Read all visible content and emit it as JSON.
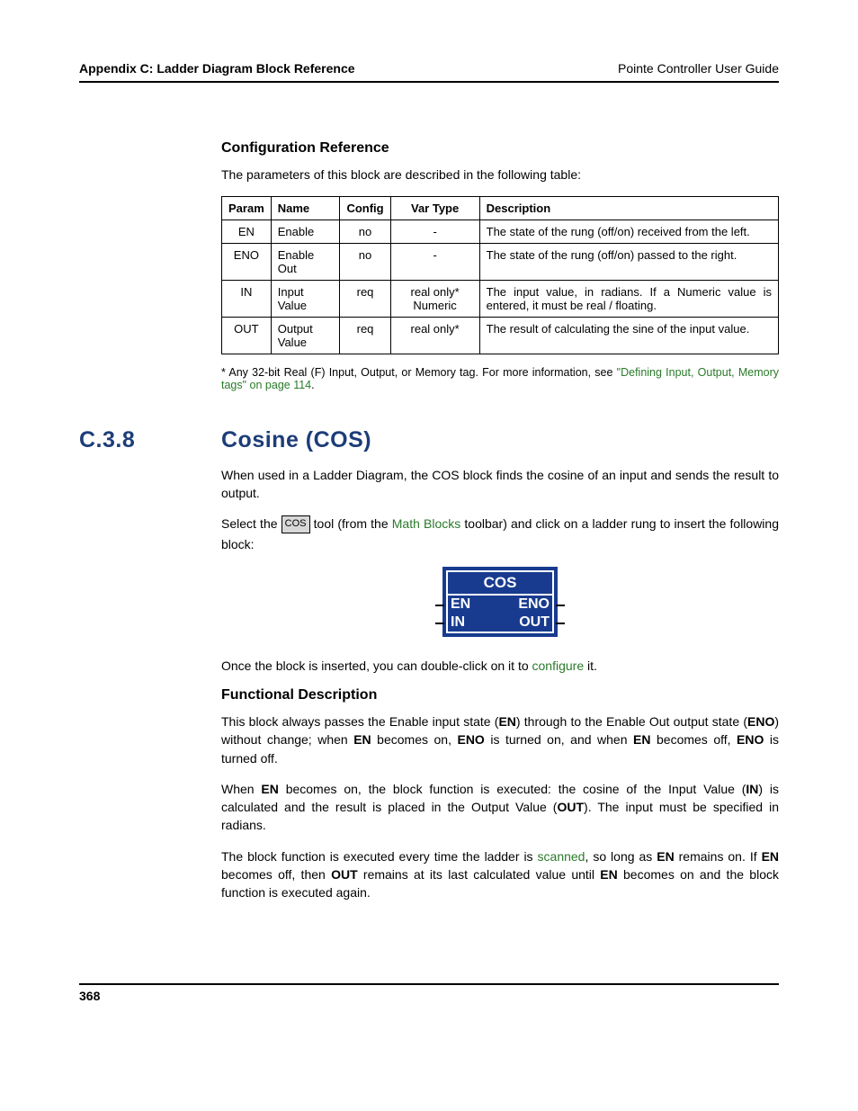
{
  "header": {
    "left": "Appendix C: Ladder Diagram Block Reference",
    "right": "Pointe Controller User Guide"
  },
  "config_ref": {
    "heading": "Configuration Reference",
    "intro": "The parameters of this block are described in the following table:",
    "th": {
      "param": "Param",
      "name": "Name",
      "config": "Config",
      "vartype": "Var Type",
      "desc": "Description"
    },
    "rows": [
      {
        "param": "EN",
        "name": "Enable",
        "config": "no",
        "vartype": "-",
        "desc": "The state of the rung (off/on) received from the left."
      },
      {
        "param": "ENO",
        "name": "Enable Out",
        "config": "no",
        "vartype": "-",
        "desc": "The state of the rung (off/on) passed to the right."
      },
      {
        "param": "IN",
        "name": "Input Value",
        "config": "req",
        "vartype": "real only* Numeric",
        "desc": "The input value, in radians. If a Numeric value is entered, it must be real / floating."
      },
      {
        "param": "OUT",
        "name": "Output Value",
        "config": "req",
        "vartype": "real only*",
        "desc": "The result of calculating the sine of the input value."
      }
    ],
    "footnote": {
      "prefix": "* Any 32-bit Real (F) Input, Output, or Memory tag. For more information, see ",
      "link": "\"Defining Input, Output, Memory tags\" on page 114",
      "suffix": "."
    }
  },
  "section": {
    "num": "C.3.8",
    "title": "Cosine (COS)"
  },
  "cos": {
    "intro": "When used in a Ladder Diagram, the COS block finds the cosine of an input and sends the result to output.",
    "p2_a": "Select the ",
    "icon": "COS",
    "p2_b": " tool (from the ",
    "math_link": "Math Blocks",
    "p2_c": " toolbar) and click on a ladder rung to insert the following block:",
    "block": {
      "title": "COS",
      "en": "EN",
      "eno": "ENO",
      "in": "IN",
      "out": "OUT"
    },
    "p3_a": "Once the block is inserted, you can double-click on it to ",
    "configure_link": "configure",
    "p3_b": " it."
  },
  "func": {
    "heading": "Functional Description",
    "p1": {
      "a": "This block always passes the Enable input state (",
      "b1": "EN",
      "b": ") through to the Enable Out output state (",
      "b2": "ENO",
      "c": ") without change; when ",
      "b3": "EN",
      "d": " becomes on, ",
      "b4": "ENO",
      "e": " is turned on, and when ",
      "b5": "EN",
      "f": " becomes off, ",
      "b6": "ENO",
      "g": " is turned off."
    },
    "p2": {
      "a": "When ",
      "b1": "EN",
      "b": " becomes on, the block function is executed: the cosine of the Input Value (",
      "b2": "IN",
      "c": ") is calculated and the result is placed in the Output Value (",
      "b3": "OUT",
      "d": "). The input must be specified in radians."
    },
    "p3": {
      "a": "The block function is executed every time the ladder is ",
      "link": "scanned",
      "b": ", so long as ",
      "b1": "EN",
      "c": " remains on. If ",
      "b2": "EN",
      "d": " becomes off, then ",
      "b3": "OUT",
      "e": " remains at its last calculated value until ",
      "b4": "EN",
      "f": " becomes on and the block function is executed again."
    }
  },
  "footer": {
    "page": "368"
  }
}
